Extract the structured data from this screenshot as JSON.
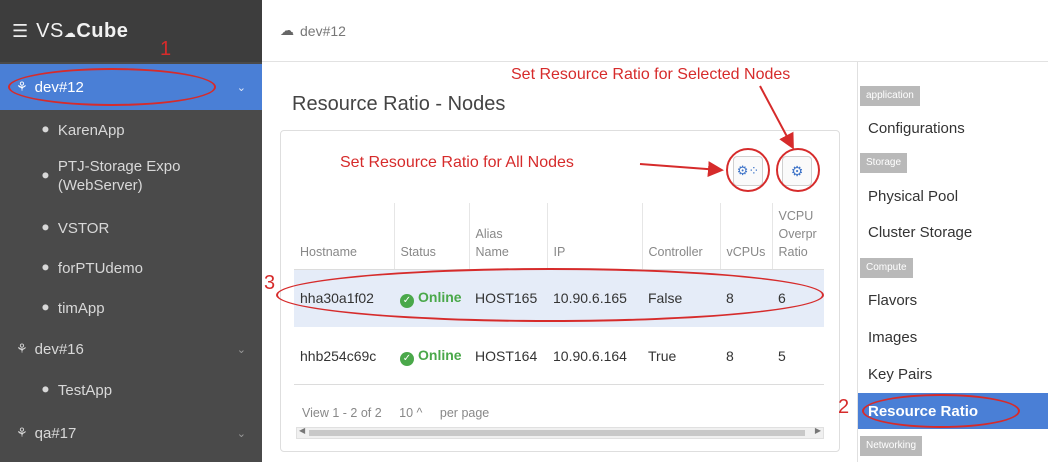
{
  "brand": {
    "menu_icon": "hamburger-icon",
    "prefix": "VS",
    "name": "Cube"
  },
  "breadcrumb": {
    "icon": "cloud-icon",
    "text": "dev#12"
  },
  "sidebar": {
    "items": [
      {
        "label": "dev#12",
        "level": 0,
        "icon": "cluster-icon",
        "active": true,
        "expandable": true
      },
      {
        "label": "KarenApp",
        "level": 1,
        "icon": "app-icon"
      },
      {
        "label": "PTJ-Storage Expo\n(WebServer)",
        "level": 1,
        "icon": "app-icon"
      },
      {
        "label": "VSTOR",
        "level": 1,
        "icon": "app-icon"
      },
      {
        "label": "forPTUdemo",
        "level": 1,
        "icon": "app-icon"
      },
      {
        "label": "timApp",
        "level": 1,
        "icon": "app-icon"
      },
      {
        "label": "dev#16",
        "level": 0,
        "icon": "cluster-icon",
        "expandable": true
      },
      {
        "label": "TestApp",
        "level": 1,
        "icon": "app-icon"
      },
      {
        "label": "qa#17",
        "level": 0,
        "icon": "cluster-icon",
        "expandable": true
      }
    ]
  },
  "main": {
    "title": "Resource Ratio - Nodes",
    "table": {
      "columns": [
        "Hostname",
        "Status",
        "Alias\nName",
        "IP",
        "Controller",
        "vCPUs",
        "VCPU\nOverpr\nRatio"
      ],
      "rows": [
        {
          "hostname": "hha30a1f02",
          "status": "Online",
          "alias": "HOST165",
          "ip": "10.90.6.165",
          "controller": "False",
          "vcpus": "8",
          "ratio": "6",
          "selected": true
        },
        {
          "hostname": "hhb254c69c",
          "status": "Online",
          "alias": "HOST164",
          "ip": "10.90.6.164",
          "controller": "True",
          "vcpus": "8",
          "ratio": "5",
          "selected": false
        }
      ]
    },
    "pager": {
      "view": "View 1 - 2 of 2",
      "page_size": "10 ^",
      "per_page": "per page"
    }
  },
  "rightmenu": {
    "sections": [
      {
        "title": "application",
        "items": [
          "Configurations"
        ]
      },
      {
        "title": "Storage",
        "items": [
          "Physical Pool",
          "Cluster Storage"
        ]
      },
      {
        "title": "Compute",
        "items": [
          "Flavors",
          "Images",
          "Key Pairs",
          "Resource Ratio"
        ]
      },
      {
        "title": "Networking",
        "items": []
      }
    ],
    "active": "Resource Ratio"
  },
  "annotations": {
    "selected_nodes": "Set Resource Ratio for Selected Nodes",
    "all_nodes": "Set Resource Ratio for All Nodes",
    "n1": "1",
    "n2": "2",
    "n3": "3"
  },
  "colors": {
    "accent": "#4a7fd6",
    "sidebar": "#4a4a4a",
    "online": "#4aa84a",
    "annotation": "#d62b2b"
  }
}
